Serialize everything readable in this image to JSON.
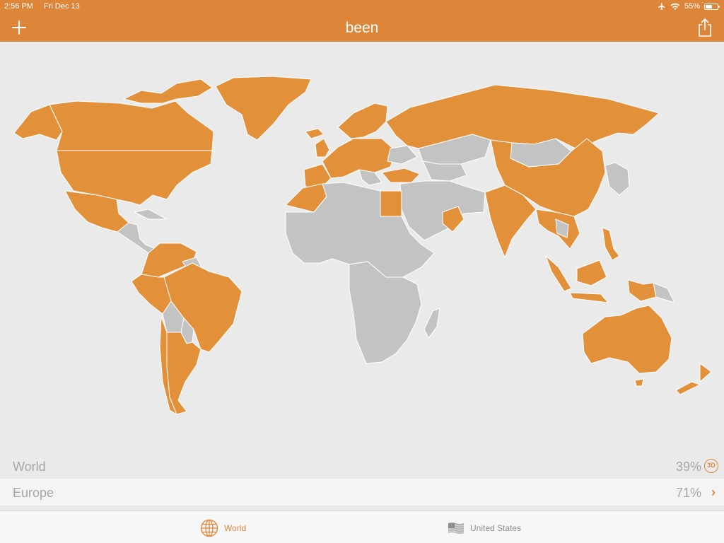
{
  "status_bar": {
    "time": "2:56 PM",
    "date": "Fri Dec 13",
    "battery": "55%",
    "battery_level": 0.55
  },
  "nav": {
    "title": "been",
    "add_icon": "plus-icon",
    "share_icon": "share-icon"
  },
  "colors": {
    "accent": "#dd8639",
    "visited": "#e2903a",
    "unvisited": "#c3c3c3",
    "background": "#eaeaea"
  },
  "stats": {
    "world": {
      "label": "World",
      "value": "39%",
      "badge": "3D"
    },
    "europe": {
      "label": "Europe",
      "value": "71%"
    }
  },
  "tabs": [
    {
      "label": "World",
      "icon": "globe-icon",
      "selected": true
    },
    {
      "label": "United States",
      "icon": "us-flag-icon",
      "selected": false
    }
  ]
}
